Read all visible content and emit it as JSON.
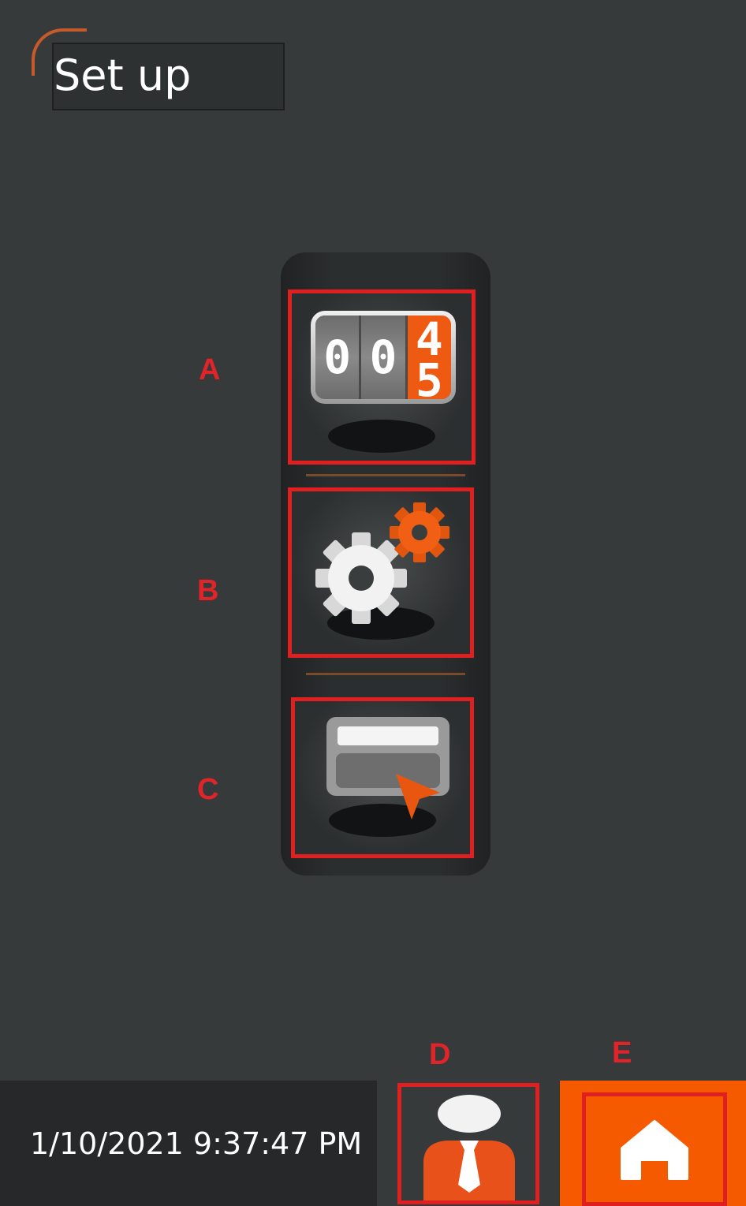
{
  "header": {
    "title": "Set up"
  },
  "menu": {
    "counter": {
      "label": "A",
      "digits": [
        "0",
        "0"
      ],
      "roll_digits": [
        "4",
        "5"
      ]
    },
    "settings": {
      "label": "B"
    },
    "screen": {
      "label": "C"
    }
  },
  "footer": {
    "datetime": "1/10/2021 9:37:47 PM",
    "user_label": "D",
    "home_label": "E"
  },
  "colors": {
    "accent": "#f55a00",
    "highlight": "#e02020",
    "background": "#363a3b"
  },
  "icons": [
    "counter-icon",
    "gears-icon",
    "screen-pointer-icon",
    "user-icon",
    "home-icon"
  ]
}
